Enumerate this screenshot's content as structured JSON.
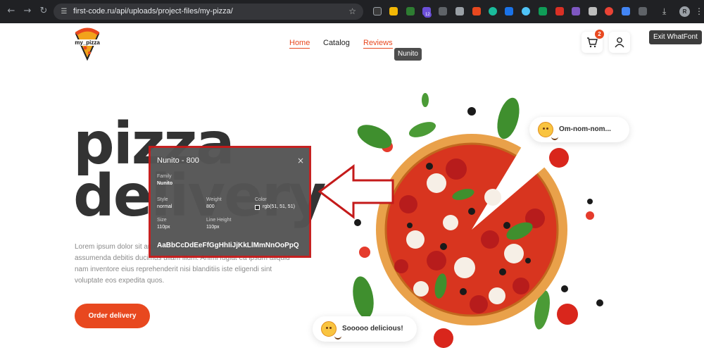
{
  "browser": {
    "url": "first-code.ru/api/uploads/project-files/my-pizza/",
    "extension_badge": "12",
    "profile_initial": "R"
  },
  "site": {
    "logo_text": "my_pizza",
    "nav": [
      {
        "label": "Home",
        "active": true
      },
      {
        "label": "Catalog",
        "active": false
      },
      {
        "label": "Reviews",
        "active": true
      }
    ],
    "cart_count": "2",
    "accent_color": "#e8481f"
  },
  "tooltips": {
    "font_hover": "Nunito",
    "exit_whatfont": "Exit WhatFont"
  },
  "hero": {
    "title_line1": "pizza",
    "title_line2": "delivery",
    "description": "Lorem ipsum dolor sit amet consectetur adipisicing elit. Nulla assumenda debitis ducimus ullam illum. Animi fugiat ea ipsum aliquid nam inventore eius reprehenderit nisi blanditiis iste eligendi sint voluptate eos expedita quos.",
    "order_button": "Order delivery"
  },
  "reviews": [
    {
      "text": "Om-nom-nom..."
    },
    {
      "text": "Sooooo delicious!"
    }
  ],
  "whatfont": {
    "title": "Nunito - 800",
    "family_label": "Family",
    "family_value": "Nunito",
    "style_label": "Style",
    "style_value": "normal",
    "weight_label": "Weight",
    "weight_value": "800",
    "color_label": "Color",
    "color_value": "rgb(51, 51, 51)",
    "size_label": "Size",
    "size_value": "110px",
    "line_height_label": "Line Height",
    "line_height_value": "110px",
    "sample": "AaBbCcDdEeFfGgHhIiJjKkLlMmNnOoPpQ",
    "close_glyph": "×",
    "swatch_color": "#333333"
  },
  "colors": {
    "chrome_bg": "#202124",
    "text_dark": "#333333",
    "panel_bg": "#555555",
    "panel_border": "#c41a1a"
  }
}
